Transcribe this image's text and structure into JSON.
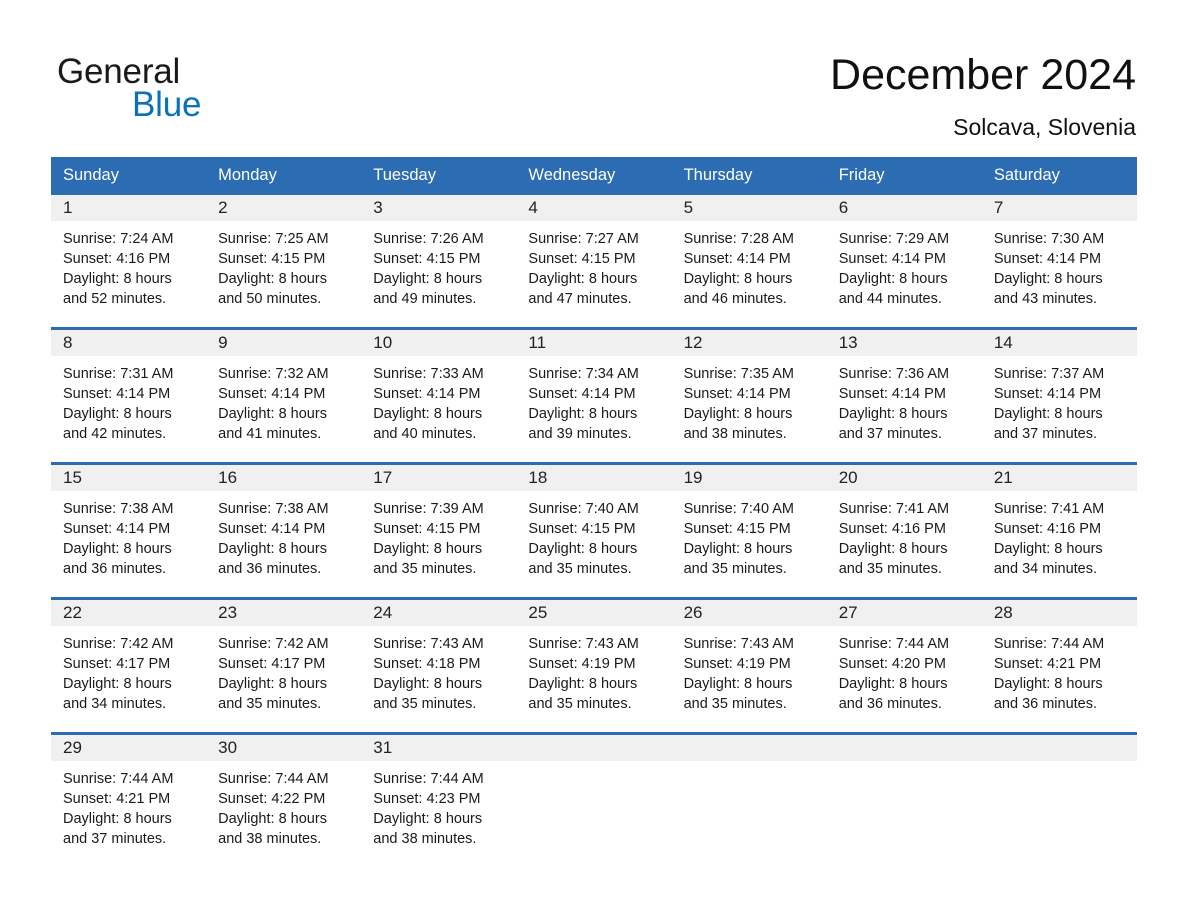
{
  "brand": {
    "name_part1": "General",
    "name_part2": "Blue",
    "triangle_color": "#0a72bb",
    "accent_color": "#2b6cb3"
  },
  "header": {
    "title": "December 2024",
    "subtitle": "Solcava, Slovenia"
  },
  "calendar": {
    "weekday_headers": [
      "Sunday",
      "Monday",
      "Tuesday",
      "Wednesday",
      "Thursday",
      "Friday",
      "Saturday"
    ],
    "weeks": [
      [
        {
          "day": "1",
          "sunrise": "Sunrise: 7:24 AM",
          "sunset": "Sunset: 4:16 PM",
          "daylight_line1": "Daylight: 8 hours",
          "daylight_line2": "and 52 minutes."
        },
        {
          "day": "2",
          "sunrise": "Sunrise: 7:25 AM",
          "sunset": "Sunset: 4:15 PM",
          "daylight_line1": "Daylight: 8 hours",
          "daylight_line2": "and 50 minutes."
        },
        {
          "day": "3",
          "sunrise": "Sunrise: 7:26 AM",
          "sunset": "Sunset: 4:15 PM",
          "daylight_line1": "Daylight: 8 hours",
          "daylight_line2": "and 49 minutes."
        },
        {
          "day": "4",
          "sunrise": "Sunrise: 7:27 AM",
          "sunset": "Sunset: 4:15 PM",
          "daylight_line1": "Daylight: 8 hours",
          "daylight_line2": "and 47 minutes."
        },
        {
          "day": "5",
          "sunrise": "Sunrise: 7:28 AM",
          "sunset": "Sunset: 4:14 PM",
          "daylight_line1": "Daylight: 8 hours",
          "daylight_line2": "and 46 minutes."
        },
        {
          "day": "6",
          "sunrise": "Sunrise: 7:29 AM",
          "sunset": "Sunset: 4:14 PM",
          "daylight_line1": "Daylight: 8 hours",
          "daylight_line2": "and 44 minutes."
        },
        {
          "day": "7",
          "sunrise": "Sunrise: 7:30 AM",
          "sunset": "Sunset: 4:14 PM",
          "daylight_line1": "Daylight: 8 hours",
          "daylight_line2": "and 43 minutes."
        }
      ],
      [
        {
          "day": "8",
          "sunrise": "Sunrise: 7:31 AM",
          "sunset": "Sunset: 4:14 PM",
          "daylight_line1": "Daylight: 8 hours",
          "daylight_line2": "and 42 minutes."
        },
        {
          "day": "9",
          "sunrise": "Sunrise: 7:32 AM",
          "sunset": "Sunset: 4:14 PM",
          "daylight_line1": "Daylight: 8 hours",
          "daylight_line2": "and 41 minutes."
        },
        {
          "day": "10",
          "sunrise": "Sunrise: 7:33 AM",
          "sunset": "Sunset: 4:14 PM",
          "daylight_line1": "Daylight: 8 hours",
          "daylight_line2": "and 40 minutes."
        },
        {
          "day": "11",
          "sunrise": "Sunrise: 7:34 AM",
          "sunset": "Sunset: 4:14 PM",
          "daylight_line1": "Daylight: 8 hours",
          "daylight_line2": "and 39 minutes."
        },
        {
          "day": "12",
          "sunrise": "Sunrise: 7:35 AM",
          "sunset": "Sunset: 4:14 PM",
          "daylight_line1": "Daylight: 8 hours",
          "daylight_line2": "and 38 minutes."
        },
        {
          "day": "13",
          "sunrise": "Sunrise: 7:36 AM",
          "sunset": "Sunset: 4:14 PM",
          "daylight_line1": "Daylight: 8 hours",
          "daylight_line2": "and 37 minutes."
        },
        {
          "day": "14",
          "sunrise": "Sunrise: 7:37 AM",
          "sunset": "Sunset: 4:14 PM",
          "daylight_line1": "Daylight: 8 hours",
          "daylight_line2": "and 37 minutes."
        }
      ],
      [
        {
          "day": "15",
          "sunrise": "Sunrise: 7:38 AM",
          "sunset": "Sunset: 4:14 PM",
          "daylight_line1": "Daylight: 8 hours",
          "daylight_line2": "and 36 minutes."
        },
        {
          "day": "16",
          "sunrise": "Sunrise: 7:38 AM",
          "sunset": "Sunset: 4:14 PM",
          "daylight_line1": "Daylight: 8 hours",
          "daylight_line2": "and 36 minutes."
        },
        {
          "day": "17",
          "sunrise": "Sunrise: 7:39 AM",
          "sunset": "Sunset: 4:15 PM",
          "daylight_line1": "Daylight: 8 hours",
          "daylight_line2": "and 35 minutes."
        },
        {
          "day": "18",
          "sunrise": "Sunrise: 7:40 AM",
          "sunset": "Sunset: 4:15 PM",
          "daylight_line1": "Daylight: 8 hours",
          "daylight_line2": "and 35 minutes."
        },
        {
          "day": "19",
          "sunrise": "Sunrise: 7:40 AM",
          "sunset": "Sunset: 4:15 PM",
          "daylight_line1": "Daylight: 8 hours",
          "daylight_line2": "and 35 minutes."
        },
        {
          "day": "20",
          "sunrise": "Sunrise: 7:41 AM",
          "sunset": "Sunset: 4:16 PM",
          "daylight_line1": "Daylight: 8 hours",
          "daylight_line2": "and 35 minutes."
        },
        {
          "day": "21",
          "sunrise": "Sunrise: 7:41 AM",
          "sunset": "Sunset: 4:16 PM",
          "daylight_line1": "Daylight: 8 hours",
          "daylight_line2": "and 34 minutes."
        }
      ],
      [
        {
          "day": "22",
          "sunrise": "Sunrise: 7:42 AM",
          "sunset": "Sunset: 4:17 PM",
          "daylight_line1": "Daylight: 8 hours",
          "daylight_line2": "and 34 minutes."
        },
        {
          "day": "23",
          "sunrise": "Sunrise: 7:42 AM",
          "sunset": "Sunset: 4:17 PM",
          "daylight_line1": "Daylight: 8 hours",
          "daylight_line2": "and 35 minutes."
        },
        {
          "day": "24",
          "sunrise": "Sunrise: 7:43 AM",
          "sunset": "Sunset: 4:18 PM",
          "daylight_line1": "Daylight: 8 hours",
          "daylight_line2": "and 35 minutes."
        },
        {
          "day": "25",
          "sunrise": "Sunrise: 7:43 AM",
          "sunset": "Sunset: 4:19 PM",
          "daylight_line1": "Daylight: 8 hours",
          "daylight_line2": "and 35 minutes."
        },
        {
          "day": "26",
          "sunrise": "Sunrise: 7:43 AM",
          "sunset": "Sunset: 4:19 PM",
          "daylight_line1": "Daylight: 8 hours",
          "daylight_line2": "and 35 minutes."
        },
        {
          "day": "27",
          "sunrise": "Sunrise: 7:44 AM",
          "sunset": "Sunset: 4:20 PM",
          "daylight_line1": "Daylight: 8 hours",
          "daylight_line2": "and 36 minutes."
        },
        {
          "day": "28",
          "sunrise": "Sunrise: 7:44 AM",
          "sunset": "Sunset: 4:21 PM",
          "daylight_line1": "Daylight: 8 hours",
          "daylight_line2": "and 36 minutes."
        }
      ],
      [
        {
          "day": "29",
          "sunrise": "Sunrise: 7:44 AM",
          "sunset": "Sunset: 4:21 PM",
          "daylight_line1": "Daylight: 8 hours",
          "daylight_line2": "and 37 minutes."
        },
        {
          "day": "30",
          "sunrise": "Sunrise: 7:44 AM",
          "sunset": "Sunset: 4:22 PM",
          "daylight_line1": "Daylight: 8 hours",
          "daylight_line2": "and 38 minutes."
        },
        {
          "day": "31",
          "sunrise": "Sunrise: 7:44 AM",
          "sunset": "Sunset: 4:23 PM",
          "daylight_line1": "Daylight: 8 hours",
          "daylight_line2": "and 38 minutes."
        },
        {
          "day": "",
          "sunrise": "",
          "sunset": "",
          "daylight_line1": "",
          "daylight_line2": ""
        },
        {
          "day": "",
          "sunrise": "",
          "sunset": "",
          "daylight_line1": "",
          "daylight_line2": ""
        },
        {
          "day": "",
          "sunrise": "",
          "sunset": "",
          "daylight_line1": "",
          "daylight_line2": ""
        },
        {
          "day": "",
          "sunrise": "",
          "sunset": "",
          "daylight_line1": "",
          "daylight_line2": ""
        }
      ]
    ]
  }
}
